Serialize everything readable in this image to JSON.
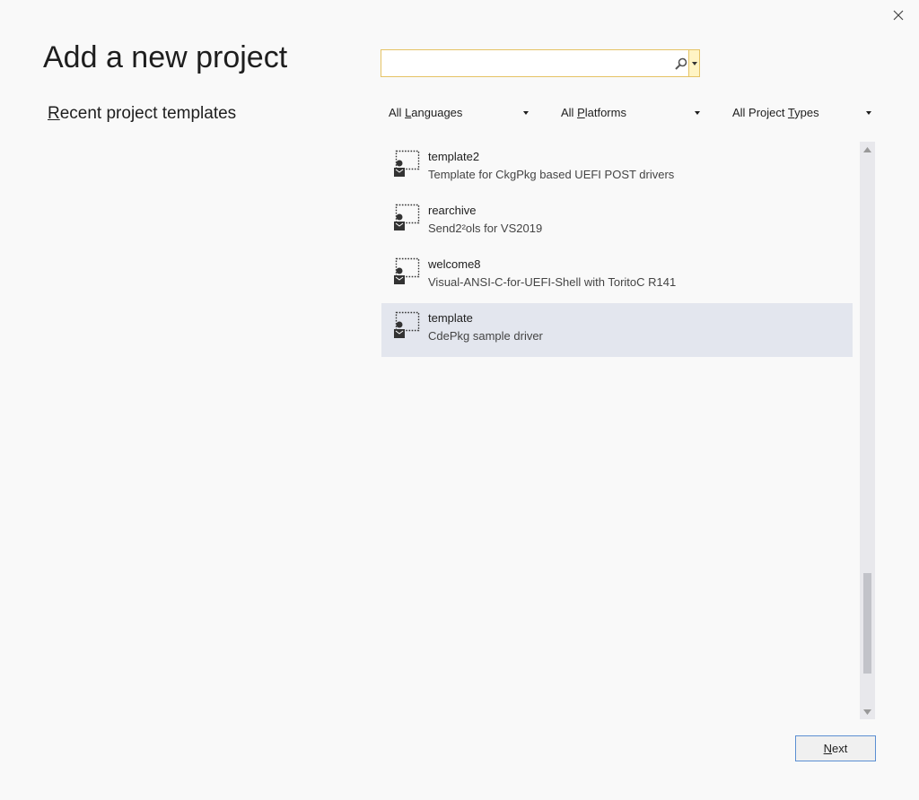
{
  "dialog": {
    "title": "Add a new project",
    "recent_label": {
      "accel": "R",
      "rest": "ecent project templates"
    }
  },
  "search": {
    "value": "",
    "placeholder": ""
  },
  "filters": [
    {
      "label": "All Languages",
      "accel_pre": "All ",
      "accel": "L",
      "accel_post": "anguages"
    },
    {
      "label": "All Platforms",
      "accel_pre": "All ",
      "accel": "P",
      "accel_post": "latforms"
    },
    {
      "label": "All Project Types",
      "accel_pre": "All Project ",
      "accel": "T",
      "accel_post": "ypes"
    }
  ],
  "templates": [
    {
      "name": "template2",
      "description": "Template for CkgPkg based UEFI POST drivers",
      "icon": "project-template-icon",
      "selected": false
    },
    {
      "name": "rearchive",
      "description": "Send2²ols for VS2019",
      "icon": "project-template-icon",
      "selected": false
    },
    {
      "name": "welcome8",
      "description": "Visual-ANSI-C-for-UEFI-Shell with ToritoC R141",
      "icon": "project-template-icon",
      "selected": false
    },
    {
      "name": "template",
      "description": "CdePkg sample driver",
      "icon": "project-template-icon",
      "selected": true
    }
  ],
  "next_button": {
    "accel": "N",
    "rest": "ext"
  },
  "colors": {
    "accent": "#5b8fd2",
    "selected_bg": "#e3e6ee",
    "search_border": "#e5c365"
  }
}
